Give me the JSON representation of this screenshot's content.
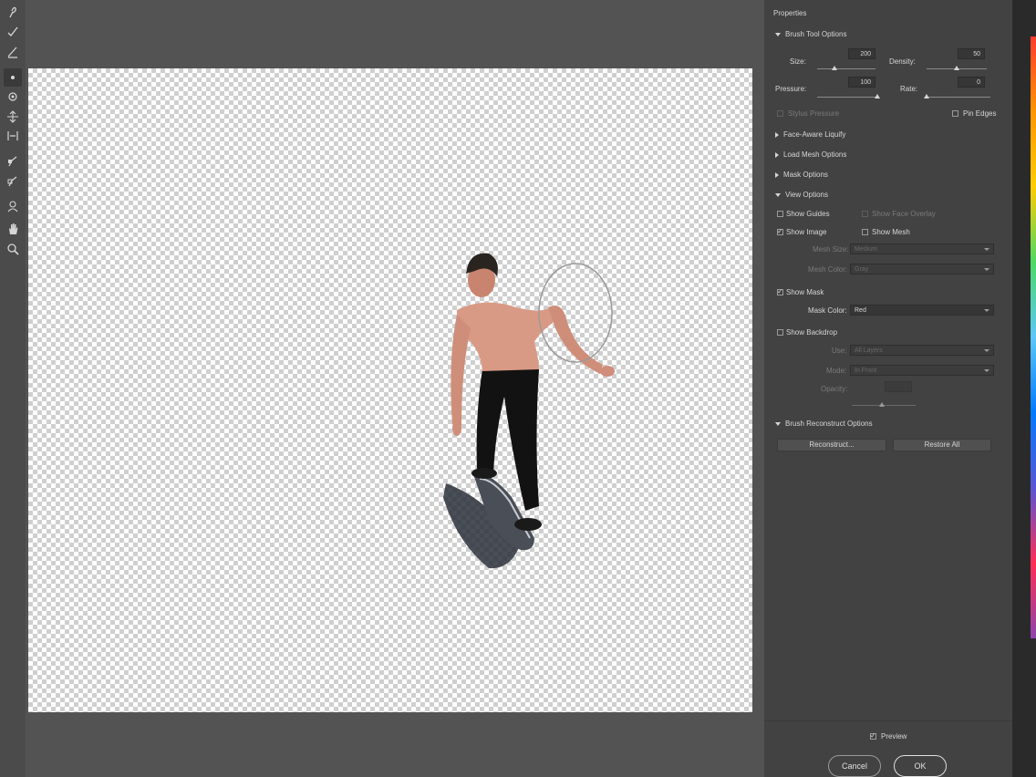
{
  "tools": [
    {
      "name": "forward-warp-tool-icon"
    },
    {
      "name": "reconstruct-tool-icon"
    },
    {
      "name": "smooth-tool-icon"
    },
    {
      "name": "twirl-tool-icon"
    },
    {
      "name": "pucker-tool-icon"
    },
    {
      "name": "bloat-tool-icon"
    },
    {
      "name": "push-left-tool-icon"
    },
    {
      "name": "freeze-mask-tool-icon"
    },
    {
      "name": "thaw-mask-tool-icon"
    },
    {
      "name": "face-tool-icon"
    },
    {
      "name": "hand-tool-icon"
    },
    {
      "name": "zoom-tool-icon"
    }
  ],
  "panel": {
    "title": "Properties",
    "brush_tool_options": {
      "label": "Brush Tool Options",
      "size_label": "Size:",
      "size_value": "200",
      "size_level": 0.3,
      "density_label": "Density:",
      "density_value": "50",
      "density_level": 0.5,
      "pressure_label": "Pressure:",
      "pressure_value": "100",
      "pressure_level": 1.0,
      "rate_label": "Rate:",
      "rate_value": "0",
      "rate_level": 0.0,
      "stylus_pressure_label": "Stylus Pressure",
      "pin_edges_label": "Pin Edges"
    },
    "sections": {
      "face_aware": "Face-Aware Liquify",
      "load_mesh": "Load Mesh Options",
      "mask": "Mask Options",
      "view": "View Options",
      "reconstruct": "Brush Reconstruct Options"
    },
    "view_options": {
      "show_guides": "Show Guides",
      "show_face_overlay": "Show Face Overlay",
      "show_image": "Show Image",
      "show_mesh": "Show Mesh",
      "mesh_size_label": "Mesh Size:",
      "mesh_size_value": "Medium",
      "mesh_color_label": "Mesh Color:",
      "mesh_color_value": "Gray",
      "show_mask": "Show Mask",
      "mask_color_label": "Mask Color:",
      "mask_color_value": "Red",
      "show_backdrop": "Show Backdrop",
      "use_label": "Use:",
      "use_value": "All Layers",
      "mode_label": "Mode:",
      "mode_value": "In Front",
      "opacity_label": "Opacity:"
    },
    "reconstruct_button": "Reconstruct...",
    "restore_all_button": "Restore All",
    "preview_label": "Preview",
    "cancel_button": "Cancel",
    "ok_button": "OK"
  }
}
